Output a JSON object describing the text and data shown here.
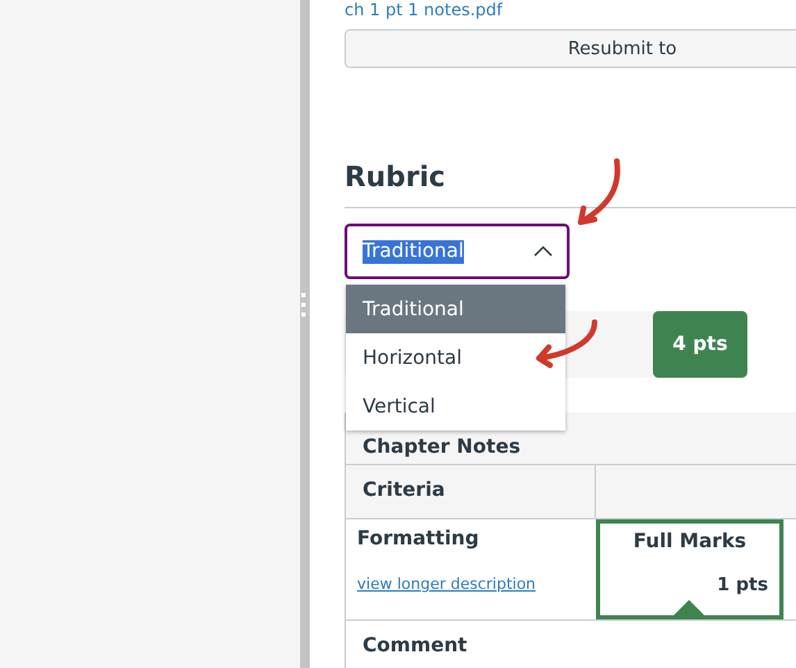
{
  "attachment_link": "ch 1 pt 1 notes.pdf",
  "resubmit_button": "Resubmit to",
  "rubric": {
    "title": "Rubric",
    "view_select": {
      "value": "Traditional",
      "expanded": true,
      "options": [
        {
          "label": "Traditional",
          "selected": true
        },
        {
          "label": "Horizontal",
          "selected": false
        },
        {
          "label": "Vertical",
          "selected": false
        }
      ]
    },
    "points_badge": "4 pts",
    "table": {
      "title": "Chapter Notes",
      "header": "Criteria",
      "rows": [
        {
          "criterion": "Formatting",
          "link": "view longer description",
          "rating": "Full Marks",
          "points": "1 pts",
          "selected": true
        }
      ],
      "comment_label": "Comment"
    }
  },
  "annotations": [
    {
      "kind": "arrow"
    },
    {
      "kind": "arrow"
    }
  ]
}
